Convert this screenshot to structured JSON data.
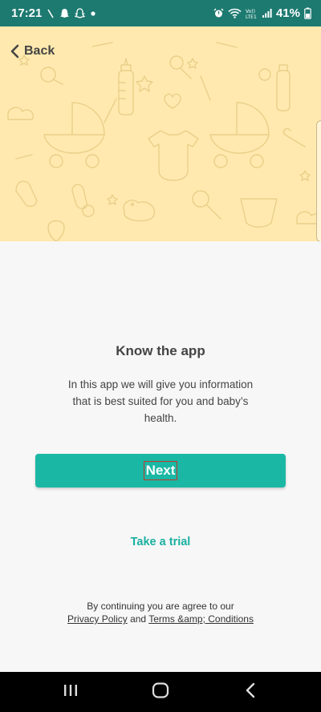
{
  "status_bar": {
    "time": "17:21",
    "battery_percent": "41%",
    "notification_icons": [
      "signal-wave-icon",
      "snapchat-icon",
      "snapchat-icon",
      "dot-icon"
    ],
    "system_icons": [
      "alarm-icon",
      "wifi-icon",
      "volte-lte-icon",
      "cell-signal-icon",
      "battery-icon"
    ]
  },
  "header": {
    "back_label": "Back",
    "background_color": "#ffe9ae"
  },
  "content": {
    "title": "Know the app",
    "description": "In this app we will give you information that is best suited for you and baby’s health."
  },
  "actions": {
    "next_label": "Next",
    "trial_label": "Take a trial"
  },
  "legal": {
    "prefix": "By continuing you are agree to our",
    "privacy_link": "Privacy Policy",
    "conjunction": "and",
    "terms_link": "Terms &amp; Conditions"
  },
  "navigation": {
    "buttons": [
      "recent-apps-icon",
      "home-icon",
      "back-nav-icon"
    ]
  },
  "colors": {
    "status_bar": "#1d7a70",
    "accent": "#1ab8a4",
    "link": "#1ab0a0",
    "text": "#444444"
  }
}
